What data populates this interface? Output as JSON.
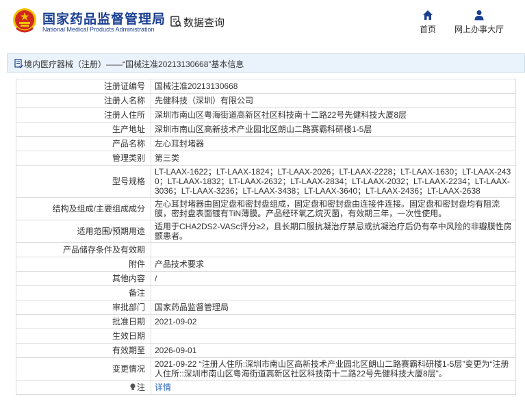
{
  "header": {
    "logo_cn": "国家药品监督管理局",
    "logo_en": "National Medical Products Administration",
    "query_label": "数据查询",
    "nav": [
      {
        "label": "首页",
        "icon": "home-icon"
      },
      {
        "label": "网上办事大厅",
        "icon": "user-icon"
      }
    ]
  },
  "title": {
    "text": "境内医疗器械（注册）——“国械注准20213130668”基本信息"
  },
  "rows": [
    {
      "label": "注册证编号",
      "value": "国械注准20213130668"
    },
    {
      "label": "注册人名称",
      "value": "先健科技（深圳）有限公司"
    },
    {
      "label": "注册人住所",
      "value": "深圳市南山区粤海街道高新区社区科技南十二路22号先健科技大厦8层"
    },
    {
      "label": "生产地址",
      "value": "深圳市南山区高新技术产业园北区朗山二路赛霸科研楼1-5层"
    },
    {
      "label": "产品名称",
      "value": "左心耳封堵器"
    },
    {
      "label": "管理类别",
      "value": "第三类"
    },
    {
      "label": "型号规格",
      "value": "LT-LAAX-1622；LT-LAAX-1824；LT-LAAX-2026；LT-LAAX-2228；LT-LAAX-1630；LT-LAAX-2430；LT-LAAX-1832；LT-LAAX-2632；LT-LAAX-2834；LT-LAAX-2032；LT-LAAX-2234；LT-LAAX-3036；LT-LAAX-3236；LT-LAAX-3438；LT-LAAX-3640；LT-LAAX-2436；LT-LAAX-2638"
    },
    {
      "label": "结构及组成/主要组成成分",
      "value": "左心耳封堵器由固定盘和密封盘组成，固定盘和密封盘由连接件连接。固定盘和密封盘均有阻流膜，密封盘表面镀有TiN薄膜。产品经环氧乙烷灭菌，有效期三年，一次性使用。"
    },
    {
      "label": "适用范围/预期用途",
      "value": "适用于CHA2DS2-VASc评分≥2，且长期口服抗凝治疗禁忌或抗凝治疗后仍有卒中风险的非瓣膜性房颤患者。"
    },
    {
      "label": "产品储存条件及有效期",
      "value": ""
    },
    {
      "label": "附件",
      "value": "产品技术要求"
    },
    {
      "label": "其他内容",
      "value": "/"
    },
    {
      "label": "备注",
      "value": ""
    },
    {
      "label": "审批部门",
      "value": "国家药品监督管理局"
    },
    {
      "label": "批准日期",
      "value": "2021-09-02"
    },
    {
      "label": "生效日期",
      "value": ""
    },
    {
      "label": "有效期至",
      "value": "2026-09-01"
    },
    {
      "label": "变更情况",
      "value": "2021-09-22 “注册人住所:深圳市南山区高新技术产业园北区朗山二路赛霸科研楼1-5层”变更为“注册人住所::深圳市南山区粤海街道高新区社区科技南十二路22号先健科技大厦8层”。"
    }
  ],
  "note_row": {
    "label": "注",
    "link_text": "详情",
    "icon": "lightbulb-icon"
  },
  "colors": {
    "brand_blue": "#1a3f91",
    "title_bg": "#eaf2fb",
    "link": "#1f5fb8",
    "emblem_red": "#d0281f",
    "emblem_gold": "#f2c200"
  }
}
